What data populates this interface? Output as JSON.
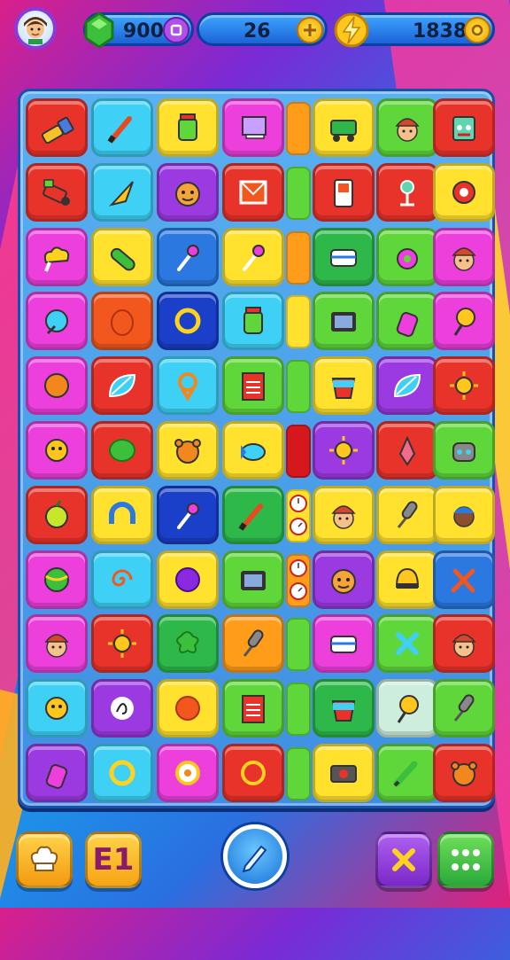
{
  "hud": {
    "gems": "900",
    "energy": "26",
    "score": "1838",
    "gems_button_icon": "plus-square-icon",
    "energy_button_icon": "plus-coin-icon",
    "score_button_icon": "coin-icon"
  },
  "bottom": {
    "level_label": "E1",
    "left_icon": "chef-hat-icon",
    "center_icon": "pencil-icon",
    "right_icon_1": "cross-icon",
    "right_icon_2": "grid-dots-icon"
  },
  "colors": {
    "board": "#3e8fe2",
    "gem": "#3cbf3a",
    "coin": "#ffc61e",
    "accent_purple": "#9a3ae0"
  },
  "board": {
    "rows": [
      [
        {
          "c": "#e8332a",
          "i": "flashlight"
        },
        {
          "c": "#3fd0f5",
          "i": "brush"
        },
        {
          "c": "#ffe12e",
          "i": "jar"
        },
        {
          "c": "#ec3fdc",
          "i": "laptop"
        },
        {
          "bar": "#ff9c1a"
        },
        {
          "c": "#ffe12e",
          "i": "cart"
        },
        {
          "c": "#5fd63a",
          "i": "face-hat"
        },
        {
          "c": "#e8332a",
          "i": "monster"
        }
      ],
      [
        {
          "c": "#e8332a",
          "i": "vacuum"
        },
        {
          "c": "#3fd0f5",
          "i": "cone"
        },
        {
          "c": "#9a3ae0",
          "i": "face"
        },
        {
          "c": "#e8332a",
          "i": "frame"
        },
        {
          "bar": "#5fd63a"
        },
        {
          "c": "#e8332a",
          "i": "device"
        },
        {
          "c": "#e8332a",
          "i": "lamp"
        },
        {
          "c": "#ffe12e",
          "i": "donut-red"
        }
      ],
      [
        {
          "c": "#ec3fdc",
          "i": "cloud"
        },
        {
          "c": "#ffe12e",
          "i": "pill"
        },
        {
          "c": "#2a78e0",
          "i": "pin"
        },
        {
          "c": "#ffe12e",
          "i": "pin"
        },
        {
          "bar": "#ff9c1a"
        },
        {
          "c": "#2eb84a",
          "i": "box"
        },
        {
          "c": "#5fd63a",
          "i": "ring-pink"
        },
        {
          "c": "#ec3fdc",
          "i": "face-hat"
        }
      ],
      [
        {
          "c": "#ec3fdc",
          "i": "globe"
        },
        {
          "c": "#f2571e",
          "i": "egg"
        },
        {
          "c": "#1a3fc8",
          "i": "ring"
        },
        {
          "c": "#3fd0f5",
          "i": "jar"
        },
        {
          "bar": "#ffe12e"
        },
        {
          "c": "#5fd63a",
          "i": "tv"
        },
        {
          "c": "#5fd63a",
          "i": "bottle"
        },
        {
          "c": "#ec3fdc",
          "i": "lolli"
        }
      ],
      [
        {
          "c": "#ec3fdc",
          "i": "sun-orange"
        },
        {
          "c": "#e8332a",
          "i": "leaf"
        },
        {
          "c": "#3fd0f5",
          "i": "knot"
        },
        {
          "c": "#5fd63a",
          "i": "book"
        },
        {
          "bar": "#5fd63a"
        },
        {
          "c": "#ffe12e",
          "i": "bucket"
        },
        {
          "c": "#9a3ae0",
          "i": "leaf"
        },
        {
          "c": "#e8332a",
          "i": "sun"
        }
      ],
      [
        {
          "c": "#ec3fdc",
          "i": "robot"
        },
        {
          "c": "#e8332a",
          "i": "ball-green"
        },
        {
          "c": "#ffe12e",
          "i": "bear"
        },
        {
          "c": "#ffe12e",
          "i": "fish"
        },
        {
          "bar": "#d6171c"
        },
        {
          "c": "#9a3ae0",
          "i": "sun"
        },
        {
          "c": "#e8332a",
          "i": "rocket"
        },
        {
          "c": "#5fd63a",
          "i": "bot"
        }
      ],
      [
        {
          "c": "#e8332a",
          "i": "apple"
        },
        {
          "c": "#ffe12e",
          "i": "horseshoe"
        },
        {
          "c": "#1a3fc8",
          "i": "pin"
        },
        {
          "c": "#2eb84a",
          "i": "brush"
        },
        {
          "bar": "#ffe12e",
          "clocks": true
        },
        {
          "c": "#ffe12e",
          "i": "face-hat"
        },
        {
          "c": "#ffe12e",
          "i": "mic"
        },
        {
          "c": "#ffe12e",
          "i": "face-dark"
        }
      ],
      [
        {
          "c": "#ec3fdc",
          "i": "ball-stripe"
        },
        {
          "c": "#3fd0f5",
          "i": "swirl"
        },
        {
          "c": "#ffe12e",
          "i": "ball-purple"
        },
        {
          "c": "#5fd63a",
          "i": "tv"
        },
        {
          "bar": "#ff9c1a",
          "clocks": true
        },
        {
          "c": "#9a3ae0",
          "i": "face"
        },
        {
          "c": "#ffe12e",
          "i": "helmet"
        },
        {
          "c": "#2a78e0",
          "i": "tools"
        }
      ],
      [
        {
          "c": "#ec3fdc",
          "i": "face-hat"
        },
        {
          "c": "#e8332a",
          "i": "sun"
        },
        {
          "c": "#2eb84a",
          "i": "splat"
        },
        {
          "c": "#ff9c1a",
          "i": "mic"
        },
        {
          "bar": "#5fd63a"
        },
        {
          "c": "#ec3fdc",
          "i": "box"
        },
        {
          "c": "#5fd63a",
          "i": "cross"
        },
        {
          "c": "#e8332a",
          "i": "face-hat"
        }
      ],
      [
        {
          "c": "#3fd0f5",
          "i": "robot"
        },
        {
          "c": "#9a3ae0",
          "i": "squiggle"
        },
        {
          "c": "#ffe12e",
          "i": "ball-red"
        },
        {
          "c": "#5fd63a",
          "i": "book"
        },
        {
          "bar": "#5fd63a"
        },
        {
          "c": "#2eb84a",
          "i": "bucket"
        },
        {
          "c": "#cdeedc",
          "i": "lolli"
        },
        {
          "c": "#5fd63a",
          "i": "mic"
        }
      ],
      [
        {
          "c": "#9a3ae0",
          "i": "bottle"
        },
        {
          "c": "#3fd0f5",
          "i": "ring"
        },
        {
          "c": "#ec3fdc",
          "i": "flower"
        },
        {
          "c": "#e8332a",
          "i": "ring-red"
        },
        {
          "bar": "#5fd63a"
        },
        {
          "c": "#ffe12e",
          "i": "camera"
        },
        {
          "c": "#5fd63a",
          "i": "pencil"
        },
        {
          "c": "#e8332a",
          "i": "bear"
        }
      ]
    ]
  }
}
